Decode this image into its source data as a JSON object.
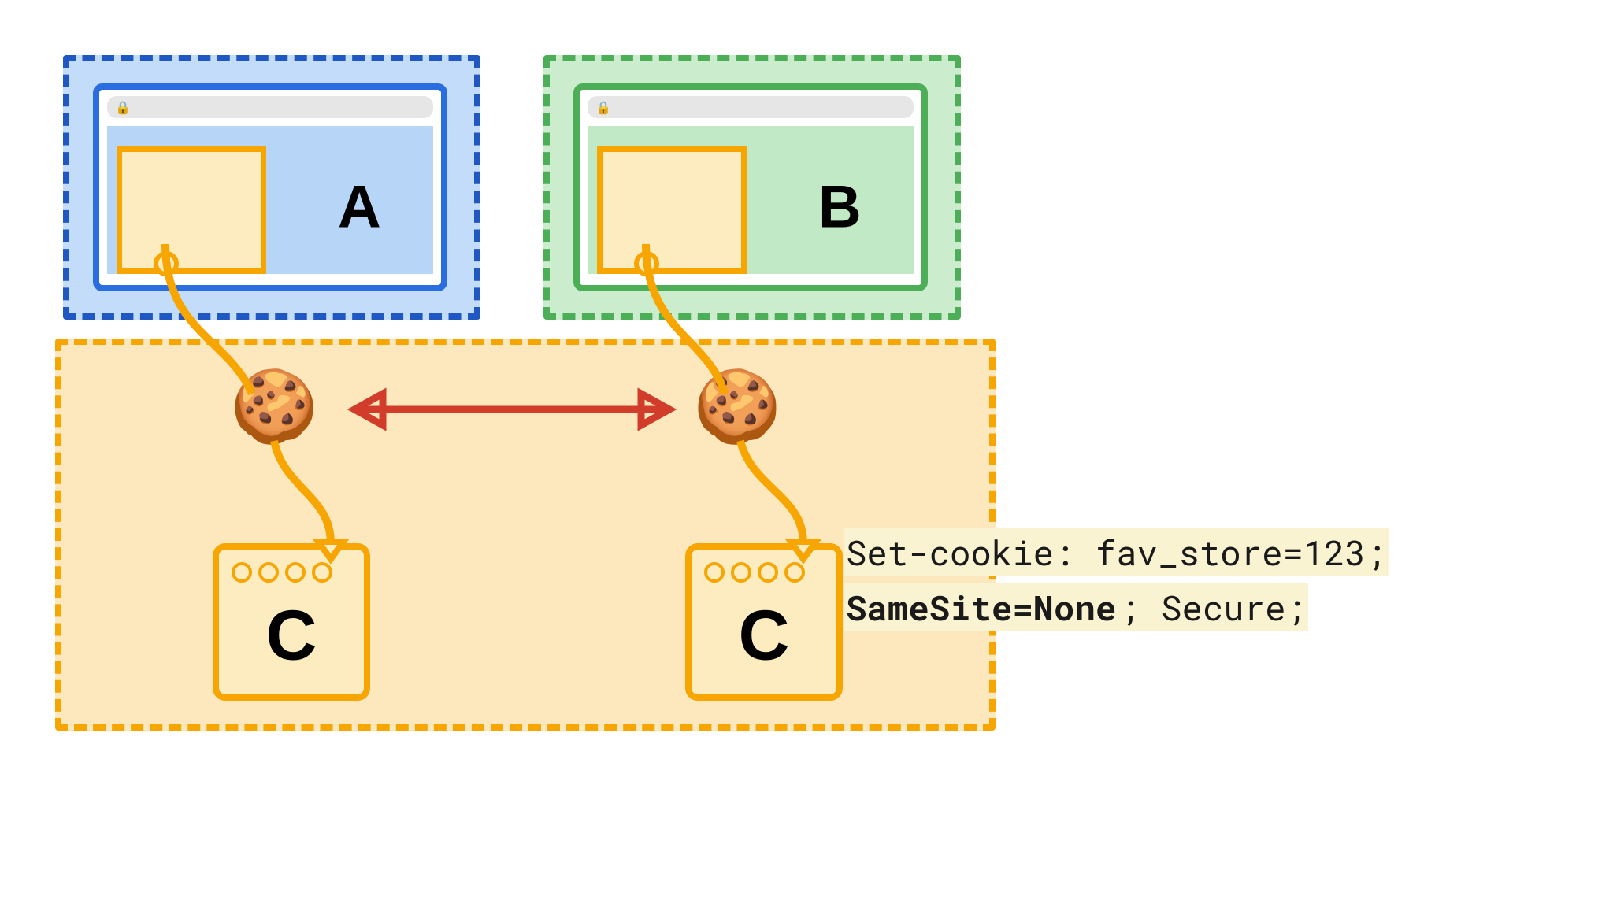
{
  "diagram": {
    "siteA": {
      "label": "A"
    },
    "siteB": {
      "label": "B"
    },
    "serverC": {
      "label_left": "C",
      "label_right": "C"
    },
    "cookie_header": {
      "line1_prefix": "Set-cookie: fav_store=123;",
      "line2_bold": "SameSite=None",
      "line2_rest": "; Secure;"
    }
  }
}
